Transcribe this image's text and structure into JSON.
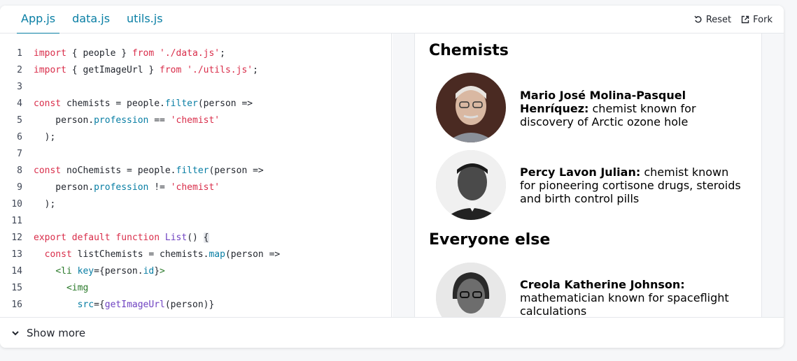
{
  "tabs": [
    {
      "label": "App.js",
      "active": true
    },
    {
      "label": "data.js",
      "active": false
    },
    {
      "label": "utils.js",
      "active": false
    }
  ],
  "actions": {
    "reset": "Reset",
    "fork": "Fork"
  },
  "code": {
    "line_numbers": [
      "1",
      "2",
      "3",
      "4",
      "5",
      "6",
      "7",
      "8",
      "9",
      "10",
      "11",
      "12",
      "13",
      "14",
      "15",
      "16"
    ]
  },
  "preview": {
    "heading_chemists": "Chemists",
    "heading_everyone": "Everyone else",
    "people": [
      {
        "name": "Mario José Molina-Pasquel Henríquez:",
        "line1_rest": "",
        "line1_name": "Mario José Molina-Pasquel",
        "line2_name": "Henríquez:",
        "line2_rest": " chemist known for",
        "line3": "discovery of Arctic ozone hole"
      },
      {
        "line1_name": "Percy Lavon Julian:",
        "line1_rest": " chemist known",
        "line2": "for pioneering cortisone drugs, steroids",
        "line3": "and birth control pills"
      },
      {
        "line1_name": "Creola Katherine Johnson:",
        "line2": "mathematician known for spaceflight",
        "line3": "calculations"
      }
    ]
  },
  "footer": {
    "show_more": "Show more"
  },
  "icons": [
    "reset-icon",
    "fork-icon",
    "chevron-down-icon"
  ],
  "colors": {
    "accent": "#087ea4",
    "keyword": "#d92d4a",
    "function": "#6f42c1",
    "tag": "#2b7a2b"
  }
}
